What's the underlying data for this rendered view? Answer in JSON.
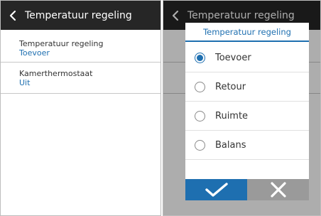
{
  "left_screen": {
    "header_title": "Temperatuur regeling",
    "items": [
      {
        "label": "Temperatuur regeling",
        "value": "Toevoer"
      },
      {
        "label": "Kamerthermostaat",
        "value": "Uit"
      }
    ]
  },
  "right_screen": {
    "header_title": "Temperatuur regeling",
    "dialog": {
      "title": "Temperatuur regeling",
      "options": [
        {
          "label": "Toevoer",
          "selected": true
        },
        {
          "label": "Retour",
          "selected": false
        },
        {
          "label": "Ruimte",
          "selected": false
        },
        {
          "label": "Balans",
          "selected": false
        }
      ]
    }
  },
  "colors": {
    "header_bg": "#262626",
    "accent": "#1e6fb0",
    "cancel_bg": "#9a9a9a"
  },
  "icons": {
    "back": "chevron-left-icon",
    "confirm": "check-icon",
    "cancel": "close-icon"
  }
}
